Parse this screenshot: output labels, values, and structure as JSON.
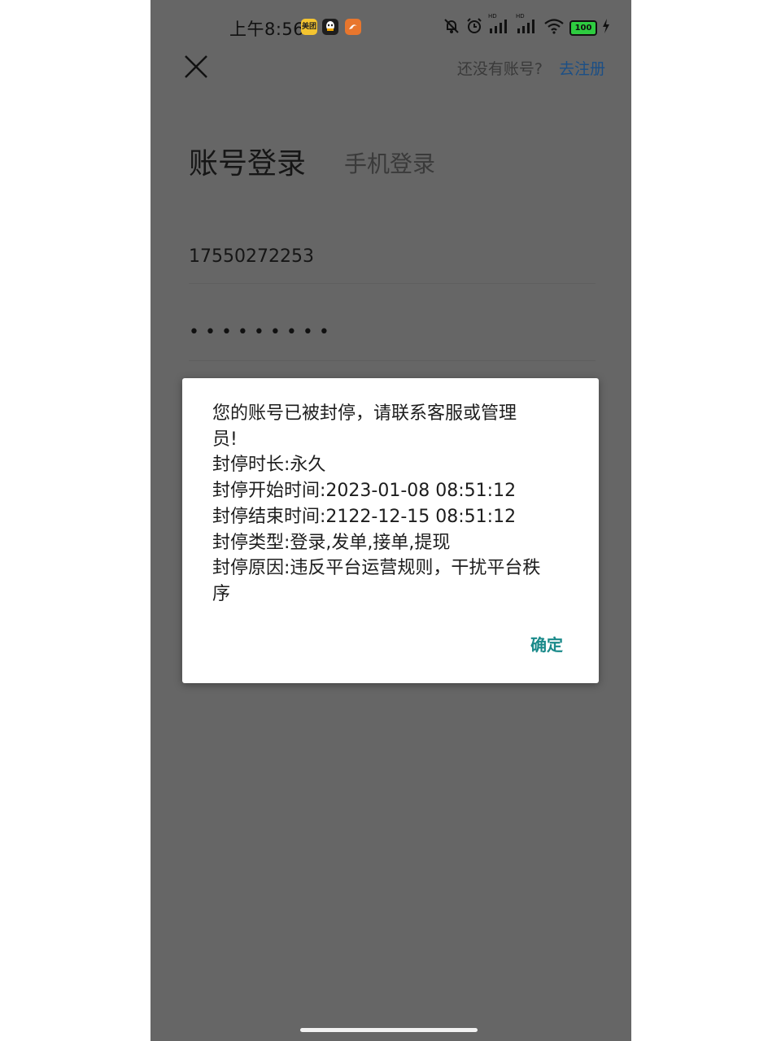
{
  "status_bar": {
    "time": "上午8:56",
    "app_icons": [
      "meituan-icon",
      "qq-icon",
      "uc-browser-icon"
    ],
    "meituan_label": "美团",
    "hd_label_1": "HD",
    "hd_label_2": "HD",
    "battery": "100",
    "system_icons": [
      "mute-icon",
      "alarm-icon",
      "signal-icon",
      "signal-icon",
      "wifi-icon",
      "battery-icon",
      "charging-icon"
    ]
  },
  "nav": {
    "no_account_text": "还没有账号?",
    "register_link": "去注册"
  },
  "tabs": {
    "account_login": "账号登录",
    "phone_login": "手机登录"
  },
  "form": {
    "account_value": "17550272253",
    "password_value": "•••••••••"
  },
  "dialog": {
    "lines": [
      "您的账号已被封停，请联系客服或管理",
      "员!",
      "封停时长:永久",
      "封停开始时间:2023-01-08 08:51:12",
      "封停结束时间:2122-12-15 08:51:12",
      "封停类型:登录,发单,接单,提现",
      "封停原因:违反平台运营规则，干扰平台秩",
      "序"
    ],
    "confirm_label": "确定"
  },
  "colors": {
    "overlay": "#666666",
    "accent_link": "#1b4f86",
    "confirm": "#1a8a8a"
  }
}
